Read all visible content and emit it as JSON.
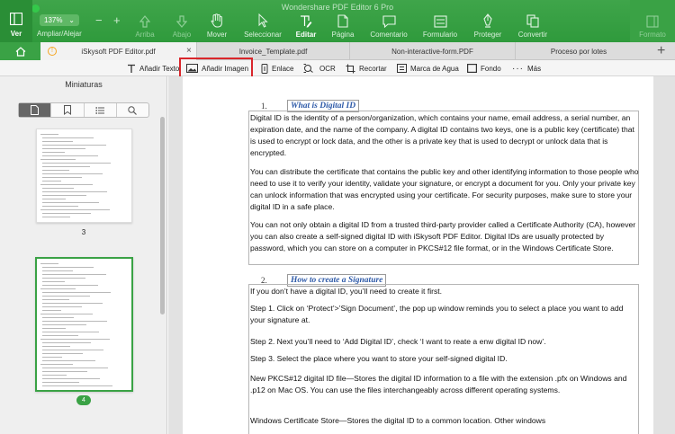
{
  "window": {
    "title": "Wondershare PDF Editor 6 Pro"
  },
  "toolbar": {
    "ver": "Ver",
    "zoom_value": "137%",
    "zoom_label": "Ampliar/Alejar",
    "arriba": "Arriba",
    "abajo": "Abajo",
    "mover": "Mover",
    "seleccionar": "Seleccionar",
    "editar": "Editar",
    "pagina": "Página",
    "comentario": "Comentario",
    "formulario": "Formulario",
    "proteger": "Proteger",
    "convertir": "Convertir",
    "formato": "Formato"
  },
  "tabs": [
    {
      "label": "iSkysoft PDF Editor.pdf"
    },
    {
      "label": "Invoice_Template.pdf"
    },
    {
      "label": "Non-interactive-form.PDF"
    },
    {
      "label": "Proceso por lotes"
    }
  ],
  "edit_tools": {
    "add_text": "Añadir Texto",
    "add_image": "Añadir Imagen",
    "link": "Enlace",
    "ocr": "OCR",
    "crop": "Recortar",
    "watermark": "Marca de Agua",
    "background": "Fondo",
    "more": "Más"
  },
  "sidebar": {
    "title": "Miniaturas",
    "thumbnails": [
      {
        "page": "3"
      },
      {
        "page": "4"
      }
    ]
  },
  "document": {
    "section1": {
      "number": "1.",
      "title": "What is Digital ID",
      "paragraphs": [
        "Digital ID is the identity of a person/organization, which contains your name, email address, a serial number, an expiration date, and the name of the company. A digital ID contains two keys, one is a public key (certificate) that is used to encrypt or lock data, and the other is a private key that is used to decrypt or unlock data that is encrypted.",
        "You can distribute the certificate that contains the public key and other identifying information to those people who need to use it to verify your identity, validate your signature, or encrypt a document for you. Only your private key can unlock information that was encrypted using your certificate. For security purposes, make sure to store your digital ID in a safe place.",
        "You can not only obtain a digital ID from a trusted third-party provider called a Certificate Authority (CA), however you can also create a self-signed digital ID with iSkysoft PDF Editor. Digital IDs are usually protected by password, which you can store on a computer in PKCS#12 file format, or in the Windows Certificate Store."
      ]
    },
    "section2": {
      "number": "2.",
      "title": "How to create a Signature",
      "paragraphs": [
        "If you don’t have a digital ID, you’ll need to create it first.",
        "Step 1. Click on ‘Protect’>’Sign Document’, the pop up window reminds you to select a place you want to add your signature at.",
        "Step 2. Next you’ll need to ‘Add Digital ID’, check ‘I want to reate a enw digital ID now’.",
        "Step 3. Select the place where you want to store your self-signed digital ID.",
        "New PKCS#12 digital ID file—Stores the digital ID information to a file with the extension .pfx on Windows and .p12 on Mac OS. You can use the files interchangeably across different operating systems.",
        "Windows Certificate Store—Stores the digital ID to a common location. Other windows"
      ]
    }
  }
}
